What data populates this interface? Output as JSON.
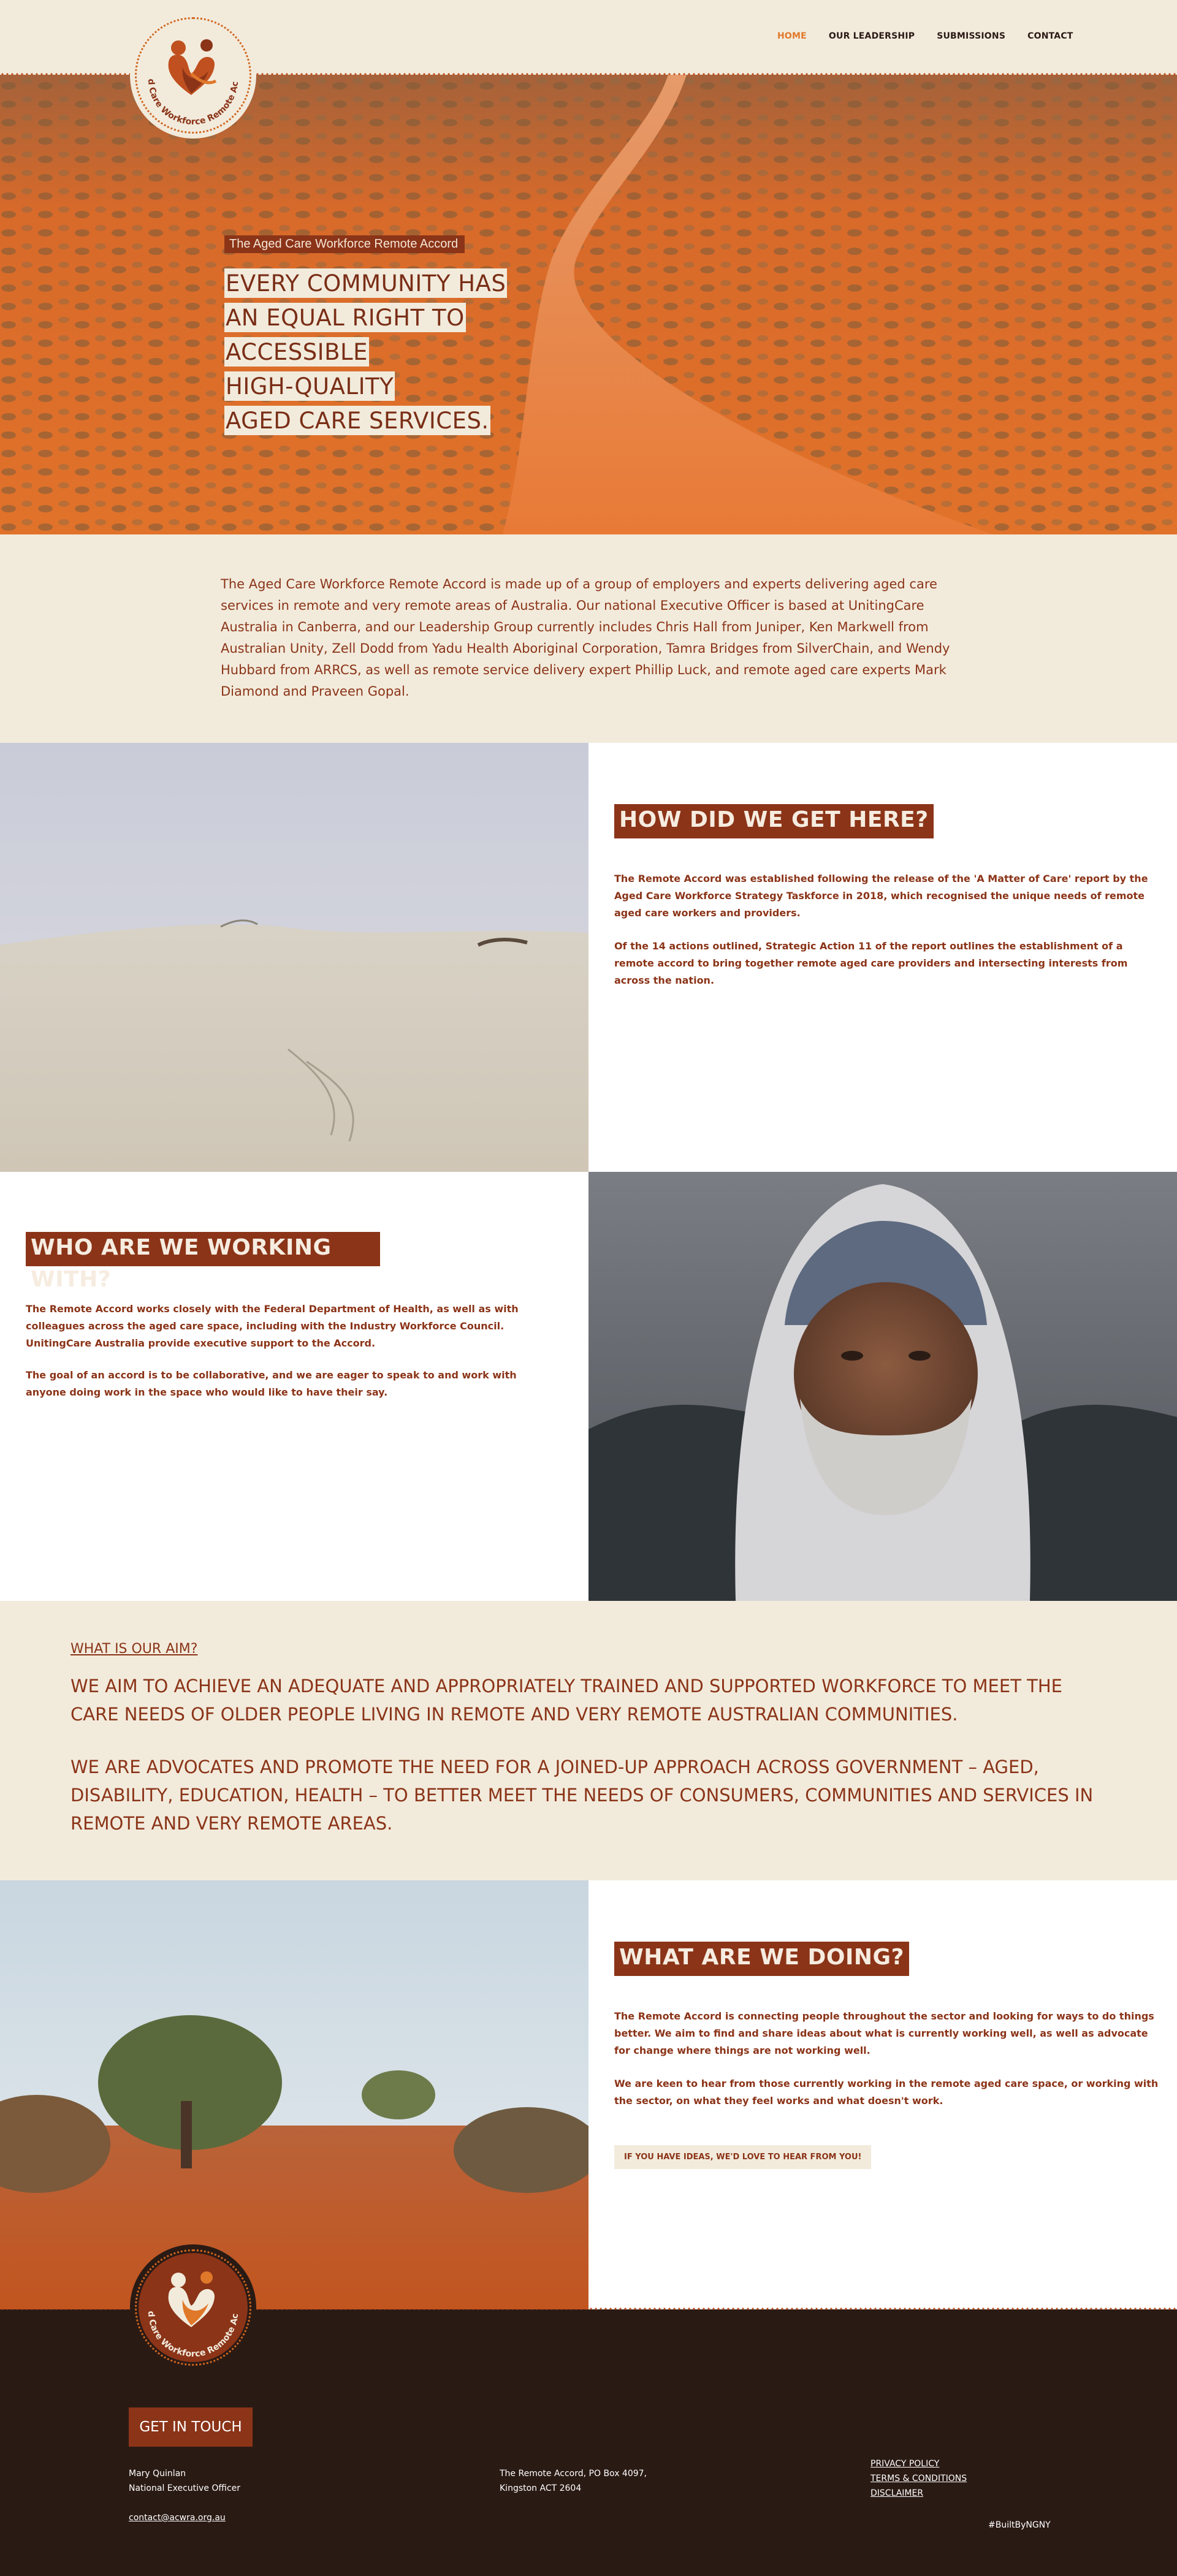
{
  "nav": {
    "items": [
      {
        "label": "HOME",
        "active": true
      },
      {
        "label": "OUR LEADERSHIP",
        "active": false
      },
      {
        "label": "SUBMISSIONS",
        "active": false
      },
      {
        "label": "CONTACT",
        "active": false
      }
    ]
  },
  "logo": {
    "text": "Aged Care Workforce Remote Accord"
  },
  "hero": {
    "eyebrow": "The Aged Care Workforce Remote Accord",
    "lines": [
      "EVERY COMMUNITY HAS",
      "AN EQUAL RIGHT TO",
      "ACCESSIBLE",
      "HIGH-QUALITY",
      "AGED CARE SERVICES."
    ]
  },
  "intro": {
    "text": "The Aged Care Workforce Remote Accord is made up of a group of employers and experts delivering aged care services in remote and very remote areas of Australia. Our national Executive Officer is based at UnitingCare Australia in Canberra, and our Leadership Group currently includes Chris Hall from Juniper, Ken Markwell from Australian Unity, Zell Dodd from Yadu Health Aboriginal Corporation, Tamra Bridges from SilverChain, and Wendy Hubbard from ARRCS, as well as remote service delivery expert Phillip Luck, and remote aged care experts Mark Diamond and Praveen Gopal."
  },
  "how": {
    "title": "HOW DID WE GET HERE?",
    "p1": "The Remote Accord was established following the release of the 'A Matter of Care' report by the Aged Care Workforce Strategy Taskforce in 2018, which recognised the unique needs of remote aged care workers and providers.",
    "p2": "Of the 14 actions outlined, Strategic Action 11 of the report outlines the establishment of a remote accord to bring together remote aged care providers and intersecting interests from across the nation."
  },
  "who": {
    "title": "WHO ARE WE WORKING WITH?",
    "p1": "The Remote Accord works closely with the Federal Department of Health, as well as with colleagues across the aged care space, including with the Industry Workforce Council. UnitingCare Australia provide executive support to the Accord.",
    "p2": "The goal of an accord is to be collaborative, and we are eager to speak to and work with anyone doing work in the space who would like to have their say."
  },
  "aim": {
    "label": "WHAT IS OUR AIM?",
    "p1": "WE AIM TO ACHIEVE AN ADEQUATE AND APPROPRIATELY TRAINED AND SUPPORTED WORKFORCE TO MEET THE CARE NEEDS OF OLDER PEOPLE LIVING IN REMOTE AND VERY REMOTE AUSTRALIAN COMMUNITIES.",
    "p2": "WE ARE ADVOCATES AND PROMOTE THE NEED FOR A JOINED-UP APPROACH ACROSS GOVERNMENT – AGED, DISABILITY, EDUCATION, HEALTH – TO BETTER MEET THE NEEDS OF CONSUMERS, COMMUNITIES AND SERVICES IN REMOTE AND VERY REMOTE AREAS."
  },
  "doing": {
    "title": "WHAT ARE WE DOING?",
    "p1": "The Remote Accord is connecting people throughout the sector and looking for ways to do things better. We aim to find and share ideas about what is currently working well, as well as advocate for change where things are not working well.",
    "p2": "We are keen to hear from those currently working in the remote aged care space, or working with the sector, on what they feel works and what doesn't work.",
    "cta": "IF YOU HAVE IDEAS, WE'D LOVE TO HEAR FROM YOU!"
  },
  "footer": {
    "cta": "GET IN TOUCH",
    "name": "Mary Quinlan",
    "role": "National Executive Officer",
    "email": "contact@acwra.org.au",
    "address1": "The Remote Accord, PO Box 4097,",
    "address2": "Kingston ACT 2604",
    "links": [
      "PRIVACY POLICY",
      "TERMS & CONDITIONS",
      "DISCLAIMER"
    ],
    "credit": "#BuiltByNGNY"
  },
  "colors": {
    "brand": "#8b3418",
    "cream": "#f2ebdc",
    "accent": "#e0782a",
    "footer_bg": "#2a1a14"
  }
}
